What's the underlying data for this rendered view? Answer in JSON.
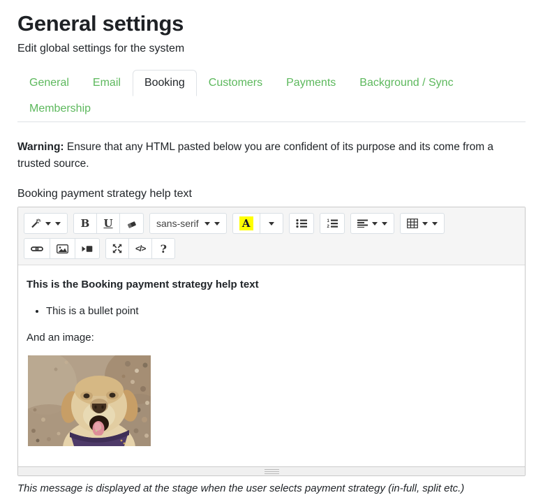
{
  "header": {
    "title": "General settings",
    "subtitle": "Edit global settings for the system"
  },
  "tabs": [
    {
      "label": "General",
      "active": false
    },
    {
      "label": "Email",
      "active": false
    },
    {
      "label": "Booking",
      "active": true
    },
    {
      "label": "Customers",
      "active": false
    },
    {
      "label": "Payments",
      "active": false
    },
    {
      "label": "Background / Sync",
      "active": false
    },
    {
      "label": "Membership",
      "active": false
    }
  ],
  "warning": {
    "label": "Warning:",
    "text": "Ensure that any HTML pasted below you are confident of its purpose and its come from a trusted source."
  },
  "field": {
    "label": "Booking payment strategy help text",
    "help": "This message is displayed at the stage when the user selects payment strategy (in-full, split etc.)"
  },
  "editor": {
    "toolbar": {
      "bold": "B",
      "underline": "U",
      "font_name": "sans-serif",
      "color": "A",
      "codeview": "</>",
      "help": "?"
    },
    "content": {
      "heading": "This is the Booking payment strategy help text",
      "bullets": [
        "This is a bullet point"
      ],
      "paragraph": "And an image:",
      "image_description": "Yellow labrador dog wearing a purple bandana on pebbly sand"
    }
  },
  "colors": {
    "tab_link_green": "#5cb85c",
    "active_tab_text": "#212529",
    "tab_border": "#dee2e6",
    "highlight_yellow": "#ffff00",
    "toolbar_bg": "#f5f5f5"
  }
}
